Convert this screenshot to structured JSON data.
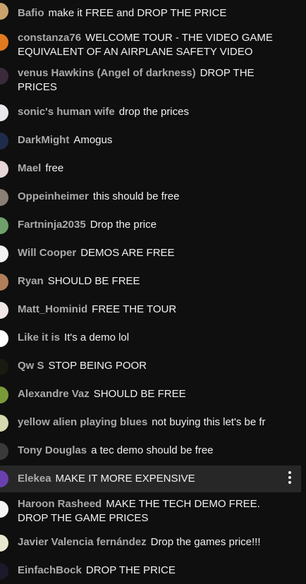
{
  "messages": [
    {
      "author": "Bafio",
      "text": "make it FREE and DROP THE PRICE",
      "avatar_color": "#c9a36b"
    },
    {
      "author": "constanza76",
      "text": "WELCOME TOUR - THE VIDEO GAME EQUIVALENT OF AN AIRPLANE SAFETY VIDEO",
      "avatar_color": "#e07a1f"
    },
    {
      "author": "venus Hawkins (Angel of darkness)",
      "text": "DROP THE PRICES",
      "avatar_color": "#3a2a3a"
    },
    {
      "author": "sonic's human wife",
      "text": "drop the prices",
      "avatar_color": "#e8e8ee"
    },
    {
      "author": "DarkMight",
      "text": "Amogus",
      "avatar_color": "#1e2b4a"
    },
    {
      "author": "Mael",
      "text": "free",
      "avatar_color": "#e6d6d6"
    },
    {
      "author": "Oppeinheimer",
      "text": "this should be free",
      "avatar_color": "#8a7f74"
    },
    {
      "author": "Fartninja2035",
      "text": "Drop the price",
      "avatar_color": "#6fa06a"
    },
    {
      "author": "Will Cooper",
      "text": "DEMOS ARE FREE",
      "avatar_color": "#f2f2f2"
    },
    {
      "author": "Ryan",
      "text": "SHOULD BE FREE",
      "avatar_color": "#b07f5a"
    },
    {
      "author": "Matt_Hominid",
      "text": "FREE THE TOUR",
      "avatar_color": "#f0e6e6"
    },
    {
      "author": "Like it is",
      "text": "It's a demo lol",
      "avatar_color": "#ffffff"
    },
    {
      "author": "Qw S",
      "text": "STOP BEING POOR",
      "avatar_color": "#1a1a10"
    },
    {
      "author": "Alexandre Vaz",
      "text": "SHOULD BE FREE",
      "avatar_color": "#7a9a3a"
    },
    {
      "author": "yellow alien playing blues",
      "text": "not buying this let's be fr",
      "avatar_color": "#d8d8b0"
    },
    {
      "author": "Tony Douglas",
      "text": "a tec demo should be free",
      "avatar_color": "#3a3a3a"
    },
    {
      "author": "Elekea",
      "text": "MAKE IT MORE EXPENSIVE",
      "avatar_color": "#6a3fb0"
    },
    {
      "author": "Haroon Rasheed",
      "text": "MAKE THE TECH DEMO FREE. DROP THE GAME PRICES",
      "avatar_color": "#f4f4f4"
    },
    {
      "author": "Javier Valencia fernández",
      "text": "Drop the games price!!!",
      "avatar_color": "#e9e6d0"
    },
    {
      "author": "EinfachBock",
      "text": "DROP THE PRICE",
      "avatar_color": "#1a1a2a"
    }
  ],
  "menu_icon": "more-vert-icon"
}
